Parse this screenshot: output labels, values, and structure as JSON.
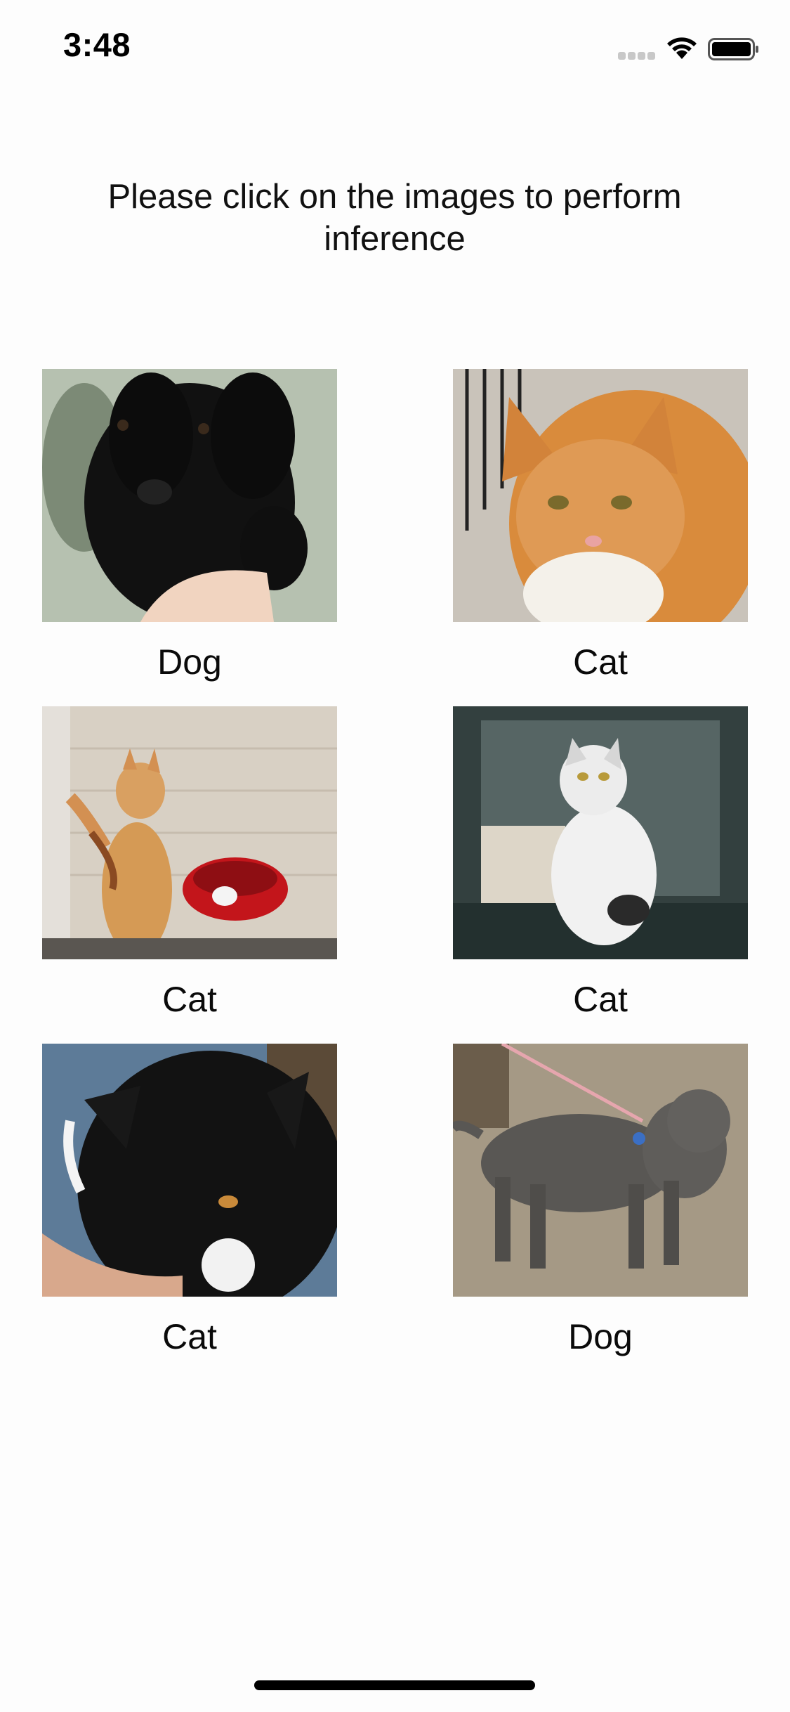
{
  "status_bar": {
    "time": "3:48",
    "icons": [
      "signal-icon",
      "wifi-icon",
      "battery-icon"
    ]
  },
  "title": "Please click on the images to perform inference",
  "images": [
    {
      "label": "Dog",
      "subject": "black-puppy-photo"
    },
    {
      "label": "Cat",
      "subject": "orange-cat-photo"
    },
    {
      "label": "Cat",
      "subject": "playing-cat-photo"
    },
    {
      "label": "Cat",
      "subject": "white-cat-photo"
    },
    {
      "label": "Cat",
      "subject": "black-cat-photo"
    },
    {
      "label": "Dog",
      "subject": "grey-dog-photo"
    }
  ],
  "colors": {
    "background": "#fdfdfd",
    "text": "#111111"
  }
}
